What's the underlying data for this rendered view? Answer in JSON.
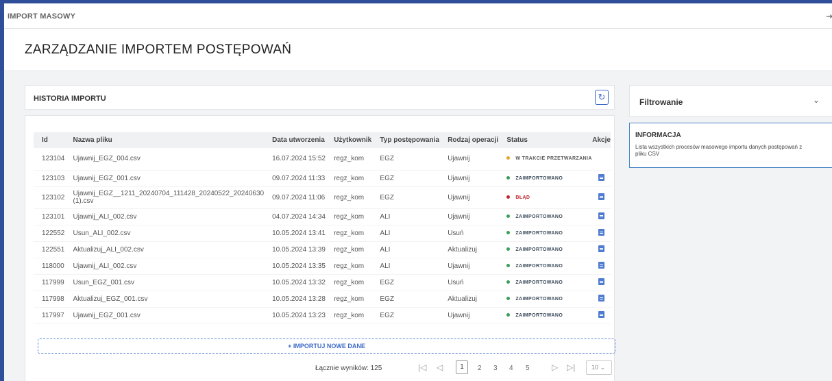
{
  "topbar": {
    "title": "IMPORT MASOWY"
  },
  "page": {
    "title": "ZARZĄDZANIE IMPORTEM POSTĘPOWAŃ"
  },
  "history": {
    "title": "HISTORIA IMPORTU",
    "columns": [
      "Id",
      "Nazwa pliku",
      "Data utworzenia",
      "Użytkownik",
      "Typ postępowania",
      "Rodzaj operacji",
      "Status",
      "Akcje"
    ],
    "rows": [
      {
        "id": "123104",
        "file": "Ujawnij_EGZ_004.csv",
        "date": "16.07.2024 15:52",
        "user": "regz_kom",
        "type": "EGZ",
        "op": "Ujawnij",
        "status": "W TRAKCIE PRZETWARZANIA",
        "status_kind": "proc"
      },
      {
        "id": "123103",
        "file": "Ujawnij_EGZ_001.csv",
        "date": "09.07.2024 11:33",
        "user": "regz_kom",
        "type": "EGZ",
        "op": "Ujawnij",
        "status": "ZAIMPORTOWANO",
        "status_kind": "ok"
      },
      {
        "id": "123102",
        "file": "Ujawnij_EGZ__1211_20240704_111428_20240522_20240630 (1).csv",
        "date": "09.07.2024 11:06",
        "user": "regz_kom",
        "type": "EGZ",
        "op": "Ujawnij",
        "status": "BŁĄD",
        "status_kind": "err"
      },
      {
        "id": "123101",
        "file": "Ujawnij_ALI_002.csv",
        "date": "04.07.2024 14:34",
        "user": "regz_kom",
        "type": "ALI",
        "op": "Ujawnij",
        "status": "ZAIMPORTOWANO",
        "status_kind": "ok"
      },
      {
        "id": "122552",
        "file": "Usun_ALI_002.csv",
        "date": "10.05.2024 13:41",
        "user": "regz_kom",
        "type": "ALI",
        "op": "Usuń",
        "status": "ZAIMPORTOWANO",
        "status_kind": "ok"
      },
      {
        "id": "122551",
        "file": "Aktualizuj_ALI_002.csv",
        "date": "10.05.2024 13:39",
        "user": "regz_kom",
        "type": "ALI",
        "op": "Aktualizuj",
        "status": "ZAIMPORTOWANO",
        "status_kind": "ok"
      },
      {
        "id": "118000",
        "file": "Ujawnij_ALI_002.csv",
        "date": "10.05.2024 13:35",
        "user": "regz_kom",
        "type": "ALI",
        "op": "Ujawnij",
        "status": "ZAIMPORTOWANO",
        "status_kind": "ok"
      },
      {
        "id": "117999",
        "file": "Usun_EGZ_001.csv",
        "date": "10.05.2024 13:32",
        "user": "regz_kom",
        "type": "EGZ",
        "op": "Usuń",
        "status": "ZAIMPORTOWANO",
        "status_kind": "ok"
      },
      {
        "id": "117998",
        "file": "Aktualizuj_EGZ_001.csv",
        "date": "10.05.2024 13:28",
        "user": "regz_kom",
        "type": "EGZ",
        "op": "Aktualizuj",
        "status": "ZAIMPORTOWANO",
        "status_kind": "ok"
      },
      {
        "id": "117997",
        "file": "Ujawnij_EGZ_001.csv",
        "date": "10.05.2024 13:23",
        "user": "regz_kom",
        "type": "EGZ",
        "op": "Ujawnij",
        "status": "ZAIMPORTOWANO",
        "status_kind": "ok"
      }
    ],
    "import_label": "+ IMPORTUJ NOWE DANE",
    "pagination": {
      "total_label": "Łącznie wyników: 125",
      "pages": [
        "1",
        "2",
        "3",
        "4",
        "5"
      ],
      "current": "1",
      "page_size": "10"
    }
  },
  "filter": {
    "title": "Filtrowanie"
  },
  "info": {
    "title": "INFORMACJA",
    "text": "Lista wszystkich procesów masowego importu danych postępowań z pliku CSV"
  },
  "colors": {
    "frame": "#2f4f9b",
    "accent": "#3c6ac8",
    "ok": "#3aa055",
    "error": "#c0282e",
    "processing": "#e0a92c"
  },
  "icons": {
    "exit": "sign-out-icon",
    "refresh": "refresh-icon",
    "chevron": "chevron-down-icon",
    "action": "document-icon"
  }
}
